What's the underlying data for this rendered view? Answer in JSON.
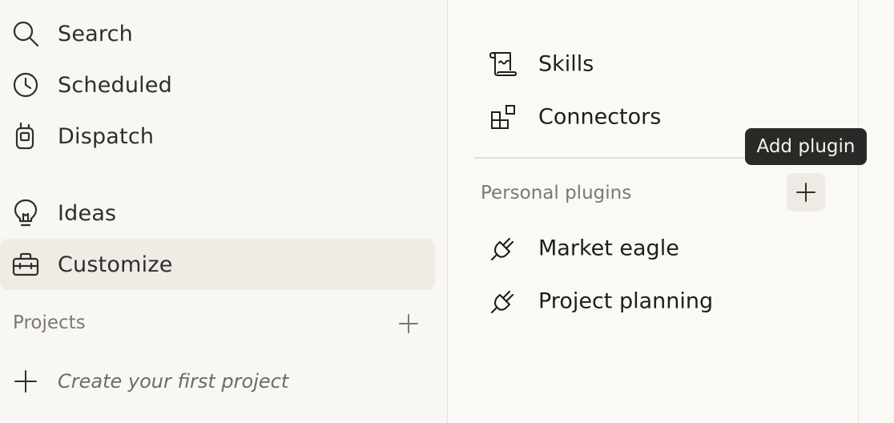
{
  "sidebar": {
    "items": [
      {
        "label": "Search",
        "icon": "search-icon"
      },
      {
        "label": "Scheduled",
        "icon": "clock-icon"
      },
      {
        "label": "Dispatch",
        "icon": "dispatch-icon"
      },
      {
        "label": "Ideas",
        "icon": "lightbulb-icon"
      },
      {
        "label": "Customize",
        "icon": "toolbox-icon",
        "active": true
      }
    ],
    "projects_title": "Projects",
    "create_project_label": "Create your first project"
  },
  "main": {
    "items": [
      {
        "label": "Skills",
        "icon": "scroll-icon"
      },
      {
        "label": "Connectors",
        "icon": "blocks-icon"
      }
    ],
    "personal_plugins_title": "Personal plugins",
    "add_plugin_tooltip": "Add plugin",
    "plugins": [
      {
        "label": "Market eagle",
        "icon": "plug-icon"
      },
      {
        "label": "Project planning",
        "icon": "plug-icon"
      }
    ]
  },
  "colors": {
    "accent_active_bg": "#efece5",
    "tooltip_bg": "#2a2927"
  }
}
